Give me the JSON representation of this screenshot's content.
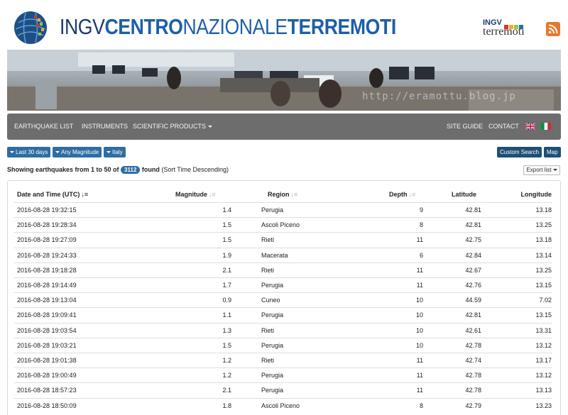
{
  "header": {
    "title_part1": "INGV",
    "title_part2": "CENTRO",
    "title_part3": "NAZIONALE",
    "title_part4": "TERREMOTI",
    "sublogo_line1": "INGV",
    "sublogo_line2": "terremoti",
    "globe_icon": "ingv-globe-logo",
    "rss_icon": "rss-icon"
  },
  "banner": {
    "watermark": "http://eramottu.blog.jp"
  },
  "nav": {
    "items": [
      "EARTHQUAKE LIST",
      "INSTRUMENTS",
      "SCIENTIFIC PRODUCTS"
    ],
    "right_items": [
      "SITE GUIDE",
      "CONTACT"
    ],
    "flags": [
      "uk-flag-icon",
      "italy-flag-icon"
    ]
  },
  "filters": {
    "buttons": [
      "Last 30 days",
      "Any Magnitude",
      "Italy"
    ],
    "custom_search": "Custom Search",
    "map": "Map"
  },
  "summary": {
    "prefix": "Showing earthquakes from 1 to 50 of",
    "count": "3112",
    "found": "found",
    "sort_note": "(Sort Time Descending)"
  },
  "export_label": "Export list",
  "table": {
    "columns": [
      "Date and Time (UTC)",
      "Magnitude",
      "Region",
      "Depth",
      "Latitude",
      "Longitude"
    ],
    "rows": [
      [
        "2016-08-28 19:32:15",
        "1.4",
        "Perugia",
        "9",
        "42.81",
        "13.18"
      ],
      [
        "2016-08-28 19:28:34",
        "1.5",
        "Ascoli Piceno",
        "8",
        "42.81",
        "13.25"
      ],
      [
        "2016-08-28 19:27:09",
        "1.5",
        "Rieti",
        "11",
        "42.75",
        "13.18"
      ],
      [
        "2016-08-28 19:24:33",
        "1.9",
        "Macerata",
        "6",
        "42.84",
        "13.14"
      ],
      [
        "2016-08-28 19:18:28",
        "2.1",
        "Rieti",
        "11",
        "42.67",
        "13.25"
      ],
      [
        "2016-08-28 19:14:49",
        "1.7",
        "Perugia",
        "11",
        "42.76",
        "13.15"
      ],
      [
        "2016-08-28 19:13:04",
        "0.9",
        "Cuneo",
        "10",
        "44.59",
        "7.02"
      ],
      [
        "2016-08-28 19:09:41",
        "1.1",
        "Perugia",
        "10",
        "42.81",
        "13.15"
      ],
      [
        "2016-08-28 19:03:54",
        "1.3",
        "Rieti",
        "10",
        "42.61",
        "13.31"
      ],
      [
        "2016-08-28 19:03:21",
        "1.5",
        "Perugia",
        "10",
        "42.78",
        "13.12"
      ],
      [
        "2016-08-28 19:01:38",
        "1.2",
        "Rieti",
        "11",
        "42.74",
        "13.17"
      ],
      [
        "2016-08-28 19:00:49",
        "1.2",
        "Perugia",
        "11",
        "42.78",
        "13.12"
      ],
      [
        "2016-08-28 18:57:23",
        "2.1",
        "Perugia",
        "11",
        "42.78",
        "13.13"
      ],
      [
        "2016-08-28 18:50:09",
        "1.8",
        "Ascoli Piceno",
        "8",
        "42.79",
        "13.23"
      ]
    ]
  },
  "colors": {
    "navbar": "#6d6d6d",
    "primary_button": "#2e6da4",
    "dark_button": "#1f4f75",
    "title_blue": "#1d5fa8"
  }
}
